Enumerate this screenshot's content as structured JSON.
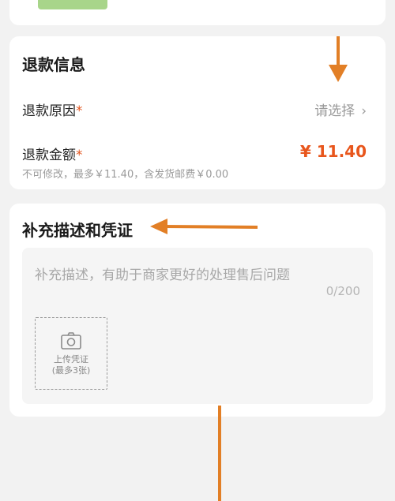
{
  "refund_info": {
    "title": "退款信息",
    "reason": {
      "label": "退款原因",
      "required_mark": "*",
      "value": "请选择",
      "chevron": "›"
    },
    "amount": {
      "label": "退款金额",
      "required_mark": "*",
      "value": "¥ 11.40",
      "note": "不可修改，最多￥11.40，含发货邮费￥0.00"
    }
  },
  "description": {
    "title": "补充描述和凭证",
    "placeholder": "补充描述，有助于商家更好的处理售后问题",
    "counter": "0/200",
    "upload": {
      "line1": "上传凭证",
      "line2": "(最多3张)",
      "icon": "camera-icon"
    }
  },
  "colors": {
    "accent": "#e8561c",
    "annotation_arrow": "#e27f26"
  }
}
